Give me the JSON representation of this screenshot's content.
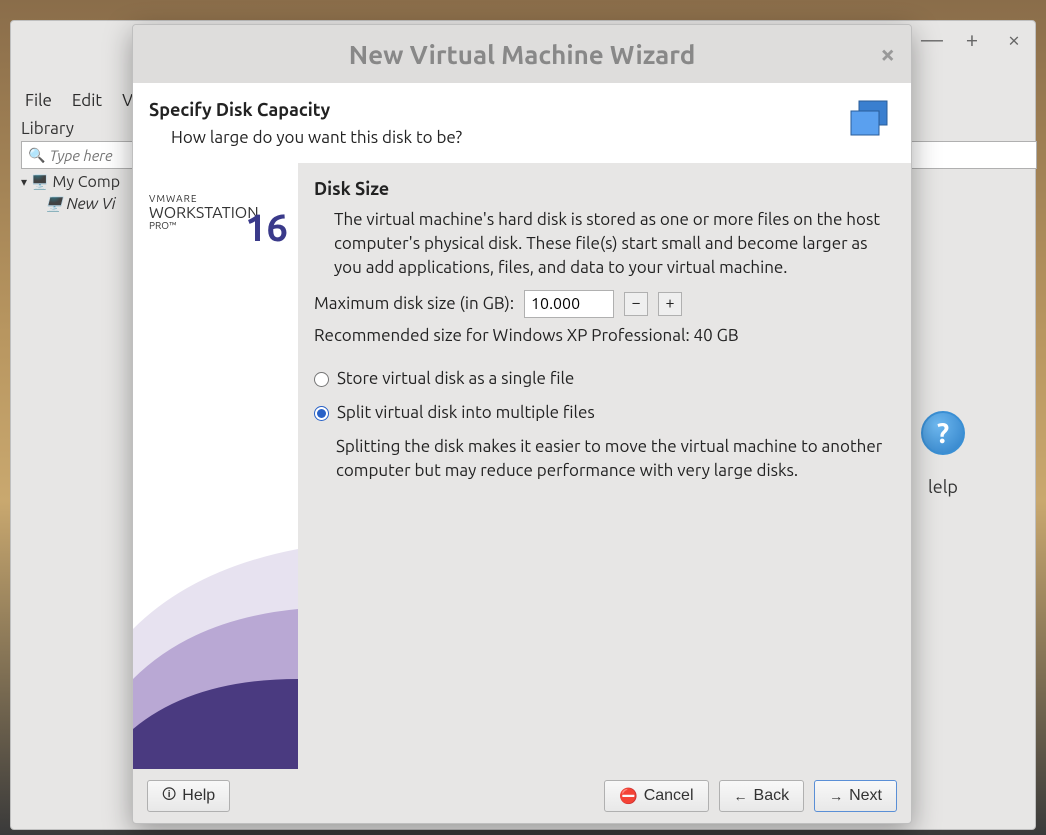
{
  "main": {
    "menubar": [
      "File",
      "Edit",
      "Vi"
    ],
    "library_label": "Library",
    "search_placeholder": "Type here",
    "tree_root": "My Comp",
    "tree_item": "New Vi",
    "help_label": "lelp"
  },
  "dialog": {
    "title": "New Virtual Machine Wizard",
    "header_title": "Specify Disk Capacity",
    "header_sub": "How large do you want this disk to be?",
    "brand_top": "VMWARE",
    "brand_mid": "WORKSTATION",
    "brand_pro": "PRO™",
    "brand_ver": "16",
    "section_title": "Disk Size",
    "description": "The virtual machine's hard disk is stored as one or more files on the host computer's physical disk. These file(s) start small and become larger as you add applications, files, and data to your virtual machine.",
    "max_label": "Maximum disk size (in GB):",
    "max_value": "10.000",
    "recommended": "Recommended size for Windows XP Professional: 40 GB",
    "option_single": "Store virtual disk as a single file",
    "option_split": "Split virtual disk into multiple files",
    "split_desc": "Splitting the disk makes it easier to move the virtual machine to another computer but may reduce performance with very large disks.",
    "help_btn": "Help",
    "cancel_btn": "Cancel",
    "back_btn": "Back",
    "next_btn": "Next"
  }
}
